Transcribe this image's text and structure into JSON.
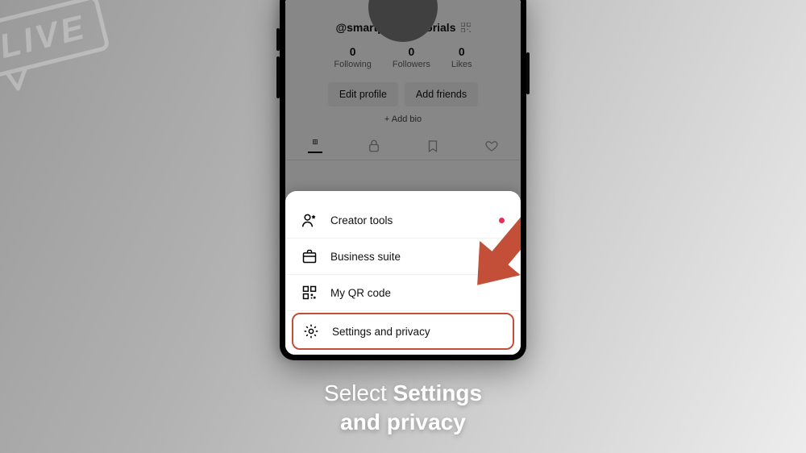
{
  "live_badge": "LIVE",
  "profile": {
    "handle": "@smartphonetutorials",
    "stats": [
      {
        "n": "0",
        "l": "Following"
      },
      {
        "n": "0",
        "l": "Followers"
      },
      {
        "n": "0",
        "l": "Likes"
      }
    ],
    "edit_btn": "Edit profile",
    "add_friends_btn": "Add friends",
    "add_bio": "+ Add bio"
  },
  "sheet": {
    "items": [
      {
        "label": "Creator tools",
        "has_dot": true
      },
      {
        "label": "Business suite"
      },
      {
        "label": "My QR code"
      },
      {
        "label": "Settings and privacy"
      }
    ]
  },
  "caption": {
    "line1_pre": "Select ",
    "line1_bold": "Settings",
    "line2_bold": "and privacy"
  }
}
